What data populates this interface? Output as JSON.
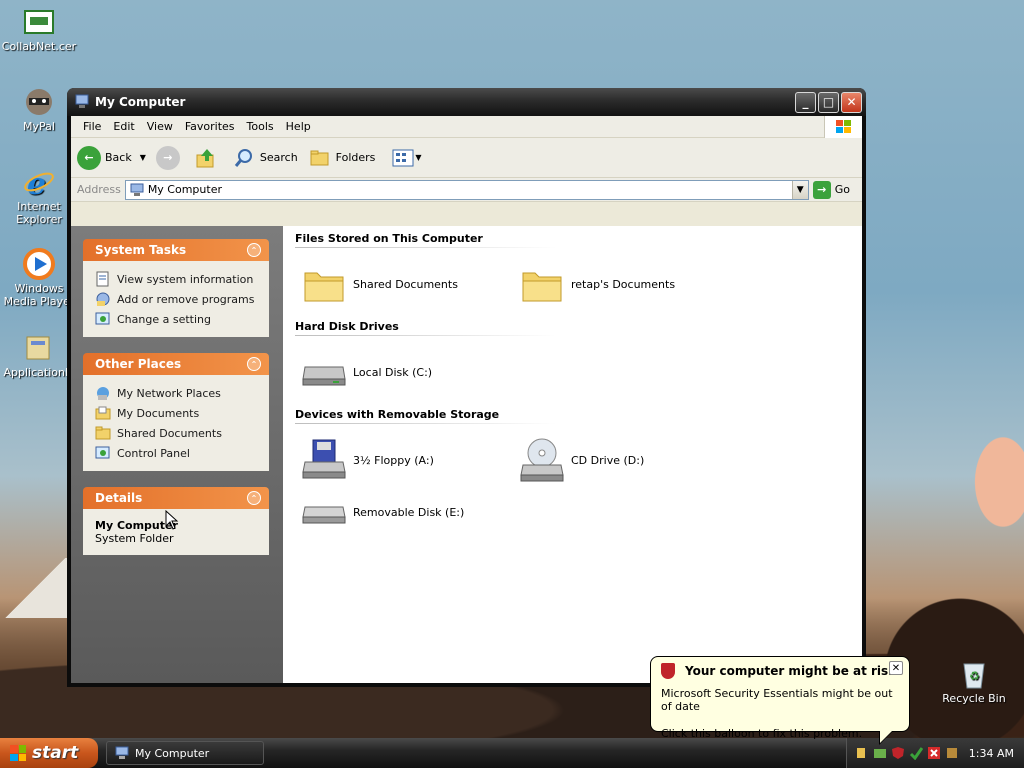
{
  "desktop": {
    "icons": [
      {
        "label": "CollabNet.cer",
        "icon": "certificate-icon"
      },
      {
        "label": "MyPal",
        "icon": "raccoon-icon"
      },
      {
        "label": "Internet Explorer",
        "icon": "ie-icon"
      },
      {
        "label": "Windows Media Player",
        "icon": "media-player-icon"
      },
      {
        "label": "ApplicationM",
        "icon": "application-icon"
      },
      {
        "label": "Recycle Bin",
        "icon": "recycle-bin-icon"
      }
    ]
  },
  "window": {
    "title": "My Computer",
    "menu": [
      "File",
      "Edit",
      "View",
      "Favorites",
      "Tools",
      "Help"
    ],
    "toolbar": {
      "back": "Back",
      "search": "Search",
      "folders": "Folders"
    },
    "address": {
      "label": "Address",
      "value": "My Computer",
      "go": "Go"
    }
  },
  "left": {
    "system_tasks": {
      "title": "System Tasks",
      "items": [
        "View system information",
        "Add or remove programs",
        "Change a setting"
      ]
    },
    "other_places": {
      "title": "Other Places",
      "items": [
        "My Network Places",
        "My Documents",
        "Shared Documents",
        "Control Panel"
      ]
    },
    "details": {
      "title": "Details",
      "name": "My Computer",
      "type": "System Folder"
    }
  },
  "main": {
    "sections": [
      {
        "title": "Files Stored on This Computer",
        "items": [
          "Shared Documents",
          "retap's Documents"
        ]
      },
      {
        "title": "Hard Disk Drives",
        "items": [
          "Local Disk (C:)"
        ]
      },
      {
        "title": "Devices with Removable Storage",
        "items": [
          "3½ Floppy (A:)",
          "CD Drive (D:)",
          "Removable Disk (E:)"
        ]
      }
    ]
  },
  "balloon": {
    "title": "Your computer might be at risk",
    "line1": "Microsoft Security Essentials might be out of date",
    "line2": "Click this balloon to fix this problem."
  },
  "taskbar": {
    "start": "start",
    "task": "My Computer",
    "clock": "1:34 AM"
  },
  "colors": {
    "accent": "#e3702a",
    "title_bar": "#121212"
  }
}
